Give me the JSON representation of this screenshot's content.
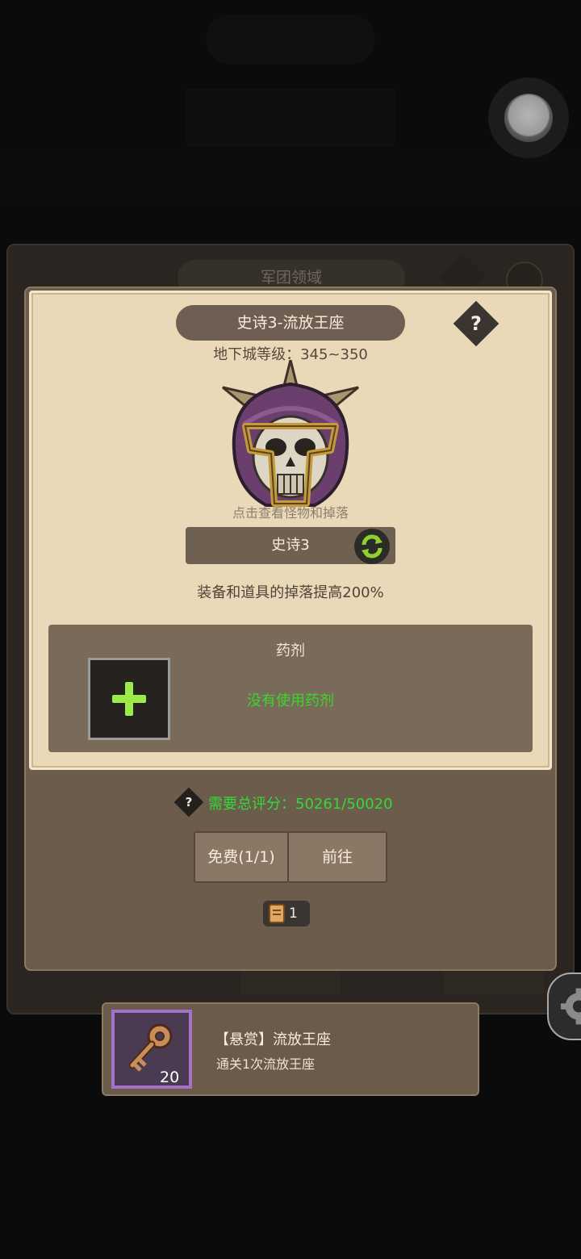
{
  "background": {
    "panel_title": "军团领域"
  },
  "dialog": {
    "title": "史诗3-流放王座",
    "help_symbol": "?",
    "level_range": "地下城等级：345~350",
    "boss_hint": "点击查看怪物和掉落",
    "difficulty_label": "史诗3",
    "drop_bonus": "装备和道具的掉落提高200%",
    "potion": {
      "title": "药剂",
      "status": "没有使用药剂"
    },
    "score": {
      "help_symbol": "?",
      "text": "需要总评分：50261/50020"
    },
    "buttons": {
      "free_label": "免费(1/1)",
      "go_label": "前往"
    },
    "ticket_count": "1"
  },
  "bounty": {
    "title": "【悬赏】流放王座",
    "description": "通关1次流放王座",
    "reward_count": "20"
  }
}
